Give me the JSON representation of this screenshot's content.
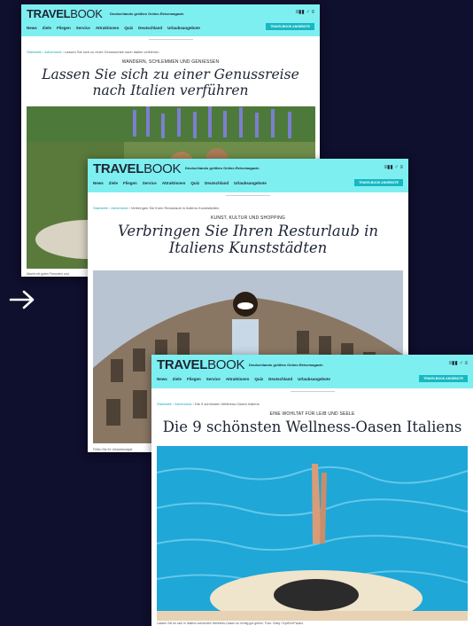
{
  "card1": {
    "logo_bold": "TRAVEL",
    "logo_light": "BOOK",
    "tagline": "Deutschlands größtes Online-Reisemagazin",
    "tools": "≡▮▮ ♂ ≡",
    "nav": [
      "News",
      "Ziele",
      "Fliegen",
      "Service",
      "Attraktionen",
      "Quiz",
      "Deutschland",
      "Urlaubsangebote"
    ],
    "cta": "TRAVELBOOK ANGEBOTE",
    "crumb_link": "Startseite › Advertorial",
    "crumb_rest": " › Lassen Sie sich zu einer Genussreise nach Italien verführen",
    "kicker": "Wandern, Schlemmen und Geniessen",
    "title": "Lassen Sie sich zu einer Genussreise nach Italien verführen",
    "caption": "Macht mit guten Freunden und"
  },
  "card2": {
    "logo_bold": "TRAVEL",
    "logo_light": "BOOK",
    "tagline": "Deutschlands größtes Online-Reisemagazin",
    "tools": "≡▮▮ ♂ ≡",
    "nav": [
      "News",
      "Ziele",
      "Fliegen",
      "Service",
      "Attraktionen",
      "Quiz",
      "Deutschland",
      "Urlaubsangebote"
    ],
    "cta": "TRAVELBOOK ANGEBOTE",
    "crumb_link": "Startseite › Advertorial",
    "crumb_rest": " › Verbringen Sie Ihren Resturlaub in Italiens Kunststädten",
    "kicker": "Kunst, Kultur und Shopping",
    "title": "Verbringen Sie Ihren Resturlaub in Italiens Kunststädten",
    "caption": "Füllen Sie Ihr Urlaubsbudget"
  },
  "card3": {
    "logo_bold": "TRAVEL",
    "logo_light": "BOOK",
    "tagline": "Deutschlands größtes Online-Reisemagazin",
    "tools": "≡▮▮ ♂ ≡",
    "nav": [
      "News",
      "Ziele",
      "Fliegen",
      "Service",
      "Attraktionen",
      "Quiz",
      "Deutschland",
      "Urlaubsangebote"
    ],
    "cta": "TRAVELBOOK ANGEBOTE",
    "crumb_link": "Startseite › Advertorial",
    "crumb_rest": " › Die 9 schönsten Wellness-Oasen Italiens",
    "kicker": "Eine Wohltat für Leib und Seele",
    "title": "Die 9 schönsten Wellness-Oasen Italiens",
    "caption": "Lassen Sie es sich in Italiens schönsten Wellness-Oasen so richtig gut gehen. Foto: Getty / EyeEm/Paulus"
  },
  "colors": {
    "header": "#7eeff0",
    "cta": "#16b8c2",
    "background": "#0f0f2e"
  },
  "icons": {
    "arrow": "arrow-right-icon"
  }
}
